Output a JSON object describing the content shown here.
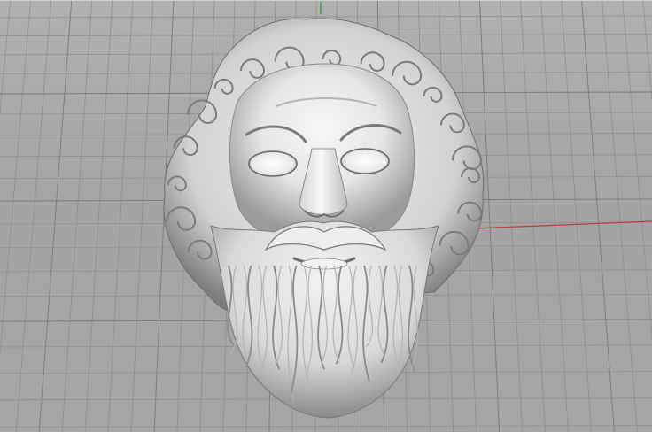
{
  "viewport": {
    "name": "perspective-viewport",
    "background_color": "#a8a8a8",
    "grid_color": "#8f8f8f",
    "major_grid_color": "#7d7d7d",
    "x_axis_color": "#c23a3a",
    "y_axis_color": "#2f9a3a"
  },
  "model": {
    "name": "bearded-head-mesh",
    "shading": "shaded",
    "surface_color": "#ececec"
  }
}
